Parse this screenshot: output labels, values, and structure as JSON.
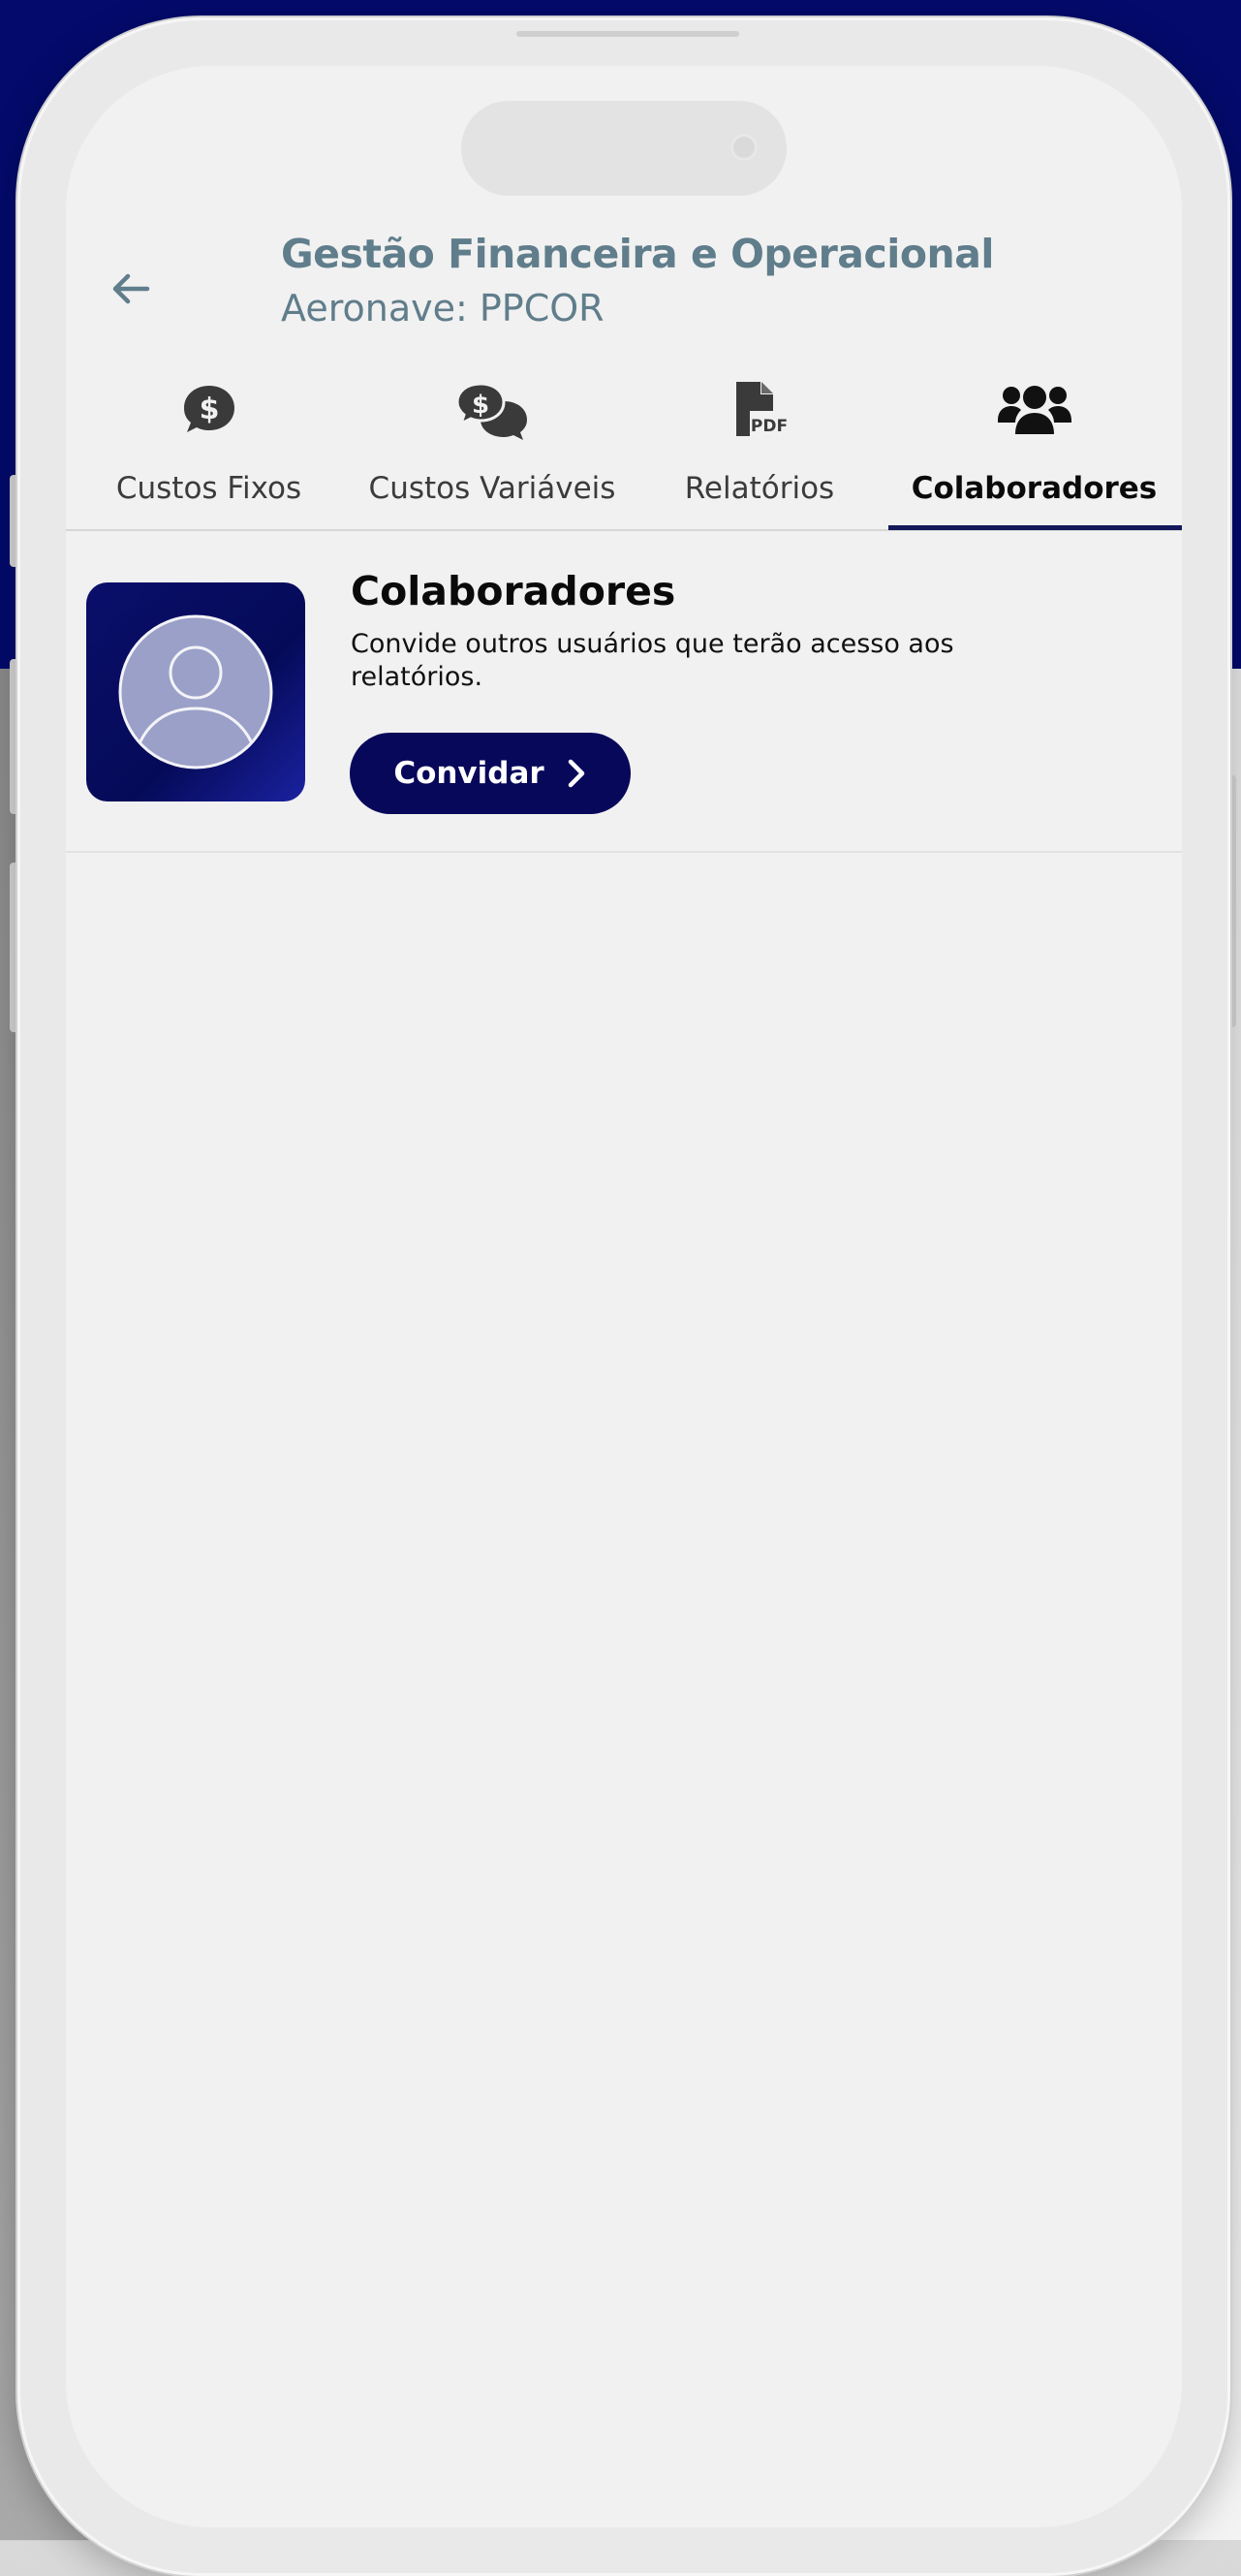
{
  "header": {
    "title": "Gestão Financeira e Operacional",
    "subtitle": "Aeronave: PPCOR"
  },
  "tabs": [
    {
      "label": "Custos Fixos",
      "icon": "dollar-chat-icon"
    },
    {
      "label": "Custos Variáveis",
      "icon": "dollar-chats-icon"
    },
    {
      "label": "Relatórios",
      "icon": "pdf-file-icon"
    },
    {
      "label": "Colaboradores",
      "icon": "users-group-icon",
      "active": true
    }
  ],
  "collaborators_card": {
    "title": "Colaboradores",
    "description": "Convide outros usuários que terão acesso aos relatórios.",
    "invite_label": "Convidar"
  },
  "colors": {
    "header_text": "#607d8b",
    "accent_dark_blue": "#07085a",
    "background_top": "#030a6b"
  }
}
